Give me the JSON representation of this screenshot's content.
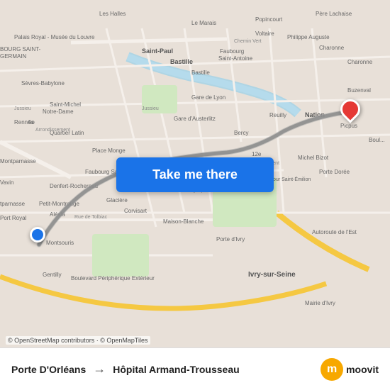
{
  "map": {
    "attribution": "© OpenStreetMap contributors · © OpenMapTiles",
    "button_label": "Take me there",
    "bg_color": "#e8e0d8"
  },
  "bottom_bar": {
    "origin": "Porte D'Orléans",
    "arrow": "→",
    "destination": "Hôpital Armand-Trousseau",
    "logo_letter": "m",
    "logo_text": "moovit"
  },
  "markers": {
    "origin_color": "#1a73e8",
    "dest_color": "#e53935"
  },
  "route": {
    "color": "#888",
    "highlight": "#aaa"
  }
}
